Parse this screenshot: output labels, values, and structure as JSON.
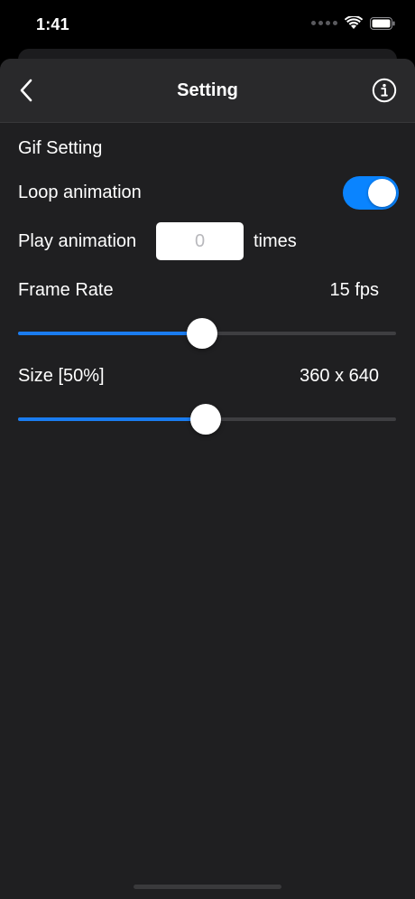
{
  "status_bar": {
    "time": "1:41",
    "icons": [
      "signal-icon",
      "wifi-icon",
      "battery-icon"
    ]
  },
  "nav": {
    "title": "Setting",
    "back_icon": "chevron-left-icon",
    "info_icon": "info-icon"
  },
  "gif_setting": {
    "section_title": "Gif Setting",
    "loop_animation": {
      "label": "Loop animation",
      "enabled": true
    },
    "play_animation": {
      "label": "Play animation",
      "input_value": "",
      "input_placeholder": "0",
      "suffix": "times"
    },
    "frame_rate": {
      "label": "Frame Rate",
      "value_text": "15 fps",
      "slider_fraction": 0.486
    },
    "size": {
      "label": "Size [50%]",
      "value_text": "360 x 640",
      "slider_fraction": 0.496
    }
  },
  "colors": {
    "accent": "#0a84ff",
    "slider_fill": "#1a7cf0",
    "background": "#1f1f21",
    "nav_background": "#29292b"
  }
}
